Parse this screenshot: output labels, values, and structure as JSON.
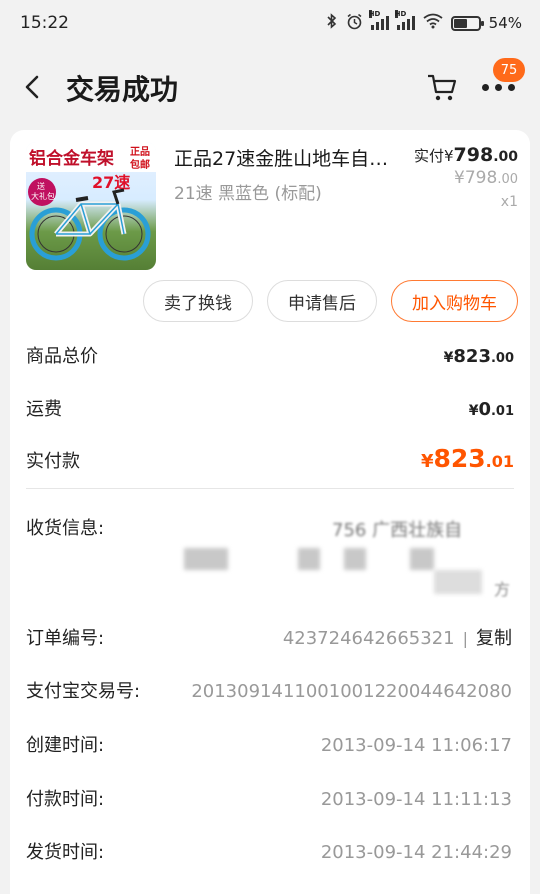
{
  "status_bar": {
    "time": "15:22",
    "battery_text": "54%",
    "battery_level": 0.54,
    "icons": [
      "bluetooth-icon",
      "alarm-icon",
      "signal-icon",
      "signal-icon",
      "wifi-icon",
      "battery-icon"
    ]
  },
  "header": {
    "title": "交易成功",
    "message_badge": "75"
  },
  "product": {
    "title": "正品27速金胜山地车自…",
    "sku": "21速 黑蓝色 (标配)",
    "paid_label": "实付",
    "paid_currency": "¥",
    "paid_int": "798",
    "paid_dec": ".00",
    "orig_currency": "¥",
    "orig_int": "798",
    "orig_dec": ".00",
    "quantity": "x1",
    "image_text": {
      "headline": "铝合金车架",
      "tag": "正品包邮",
      "speed": "27速",
      "gift": "送大礼包"
    }
  },
  "actions": [
    {
      "label": "卖了换钱"
    },
    {
      "label": "申请售后"
    },
    {
      "label": "加入购物车"
    }
  ],
  "summary": {
    "total_label": "商品总价",
    "total_currency": "¥",
    "total_int": "823",
    "total_dec": ".00",
    "shipping_label": "运费",
    "shipping_currency": "¥",
    "shipping_int": "0",
    "shipping_dec": ".01",
    "paid_label": "实付款",
    "paid_currency": "¥",
    "paid_int": "823",
    "paid_dec": ".01"
  },
  "address": {
    "label": "收货信息:",
    "visible_fragment": "756 广西壮族自",
    "tail_fragment": "方"
  },
  "order_info": {
    "order_no_label": "订单编号:",
    "order_no": "423724642665321",
    "copy_label": "复制",
    "alipay_label": "支付宝交易号:",
    "alipay_no": "2013091411001001220044642080",
    "created_label": "创建时间:",
    "created": "2013-09-14 11:06:17",
    "paid_label": "付款时间:",
    "paid": "2013-09-14 11:11:13",
    "shipped_label": "发货时间:",
    "shipped": "2013-09-14 21:44:29"
  }
}
